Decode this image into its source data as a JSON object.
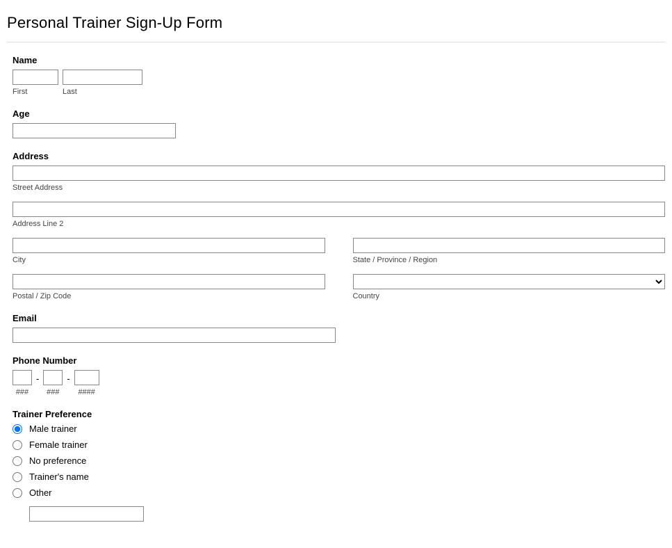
{
  "title": "Personal Trainer Sign-Up Form",
  "name": {
    "label": "Name",
    "first_sub": "First",
    "last_sub": "Last"
  },
  "age": {
    "label": "Age"
  },
  "address": {
    "label": "Address",
    "street_sub": "Street Address",
    "line2_sub": "Address Line 2",
    "city_sub": "City",
    "state_sub": "State / Province / Region",
    "postal_sub": "Postal / Zip Code",
    "country_sub": "Country"
  },
  "email": {
    "label": "Email"
  },
  "phone": {
    "label": "Phone Number",
    "sub1": "###",
    "sub2": "###",
    "sub3": "####",
    "dash": "-"
  },
  "trainer_pref": {
    "label": "Trainer Preference",
    "options": {
      "male": "Male trainer",
      "female": "Female trainer",
      "none": "No preference",
      "named": "Trainer's name",
      "other": "Other"
    }
  }
}
